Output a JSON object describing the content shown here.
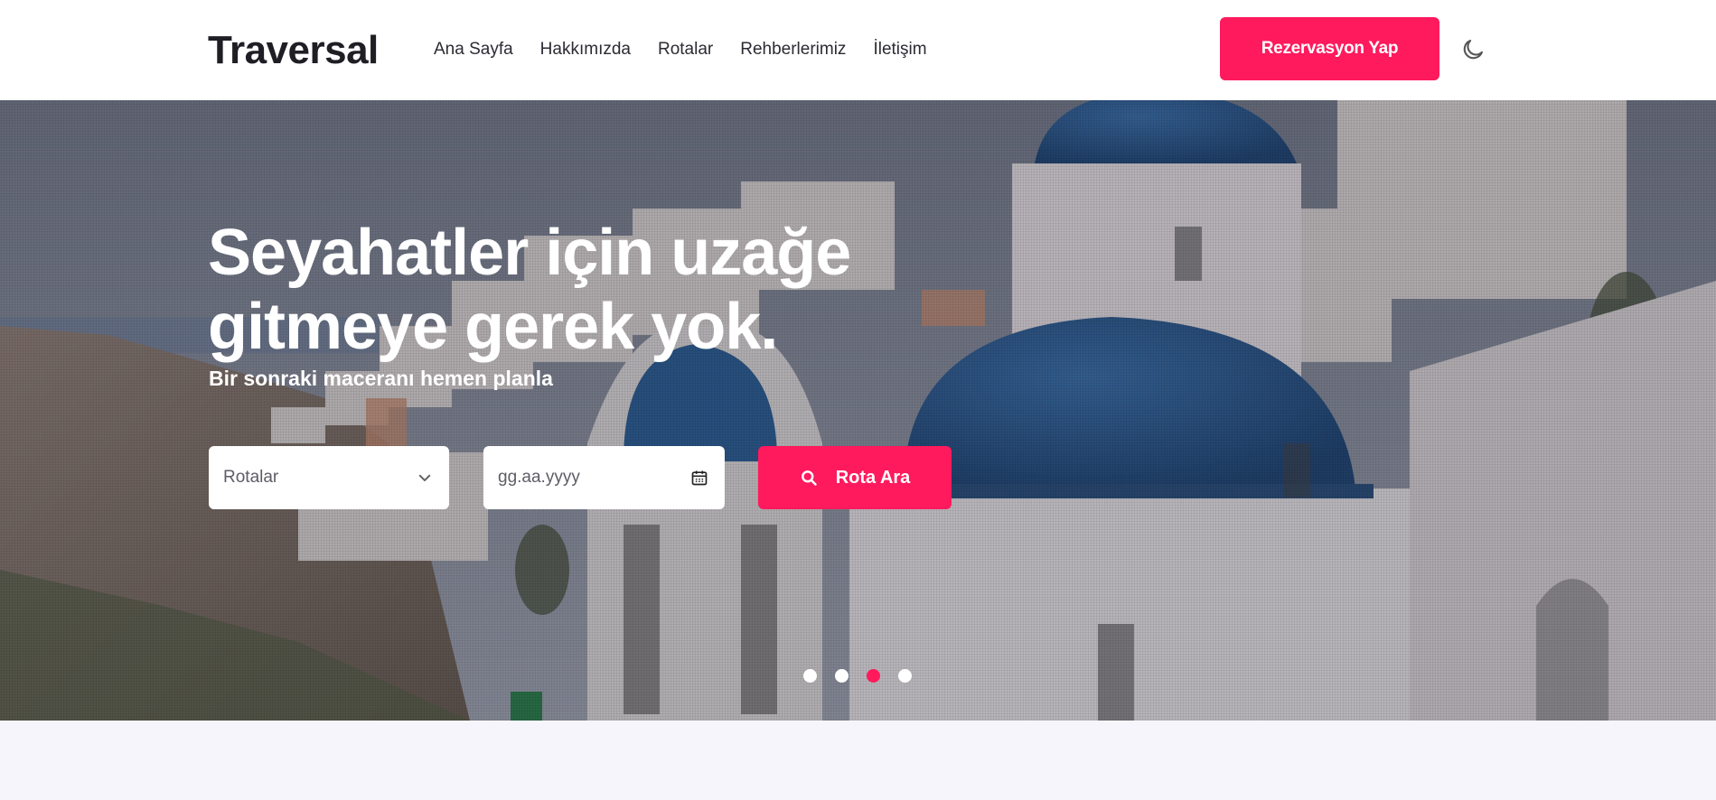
{
  "brand": {
    "name": "Traversal",
    "accent_color": "#fe1a5d"
  },
  "nav": {
    "items": [
      {
        "label": "Ana Sayfa"
      },
      {
        "label": "Hakkımızda"
      },
      {
        "label": "Rotalar"
      },
      {
        "label": "Rehberlerimiz"
      },
      {
        "label": "İletişim"
      }
    ],
    "reserve_label": "Rezervasyon Yap",
    "theme_icon": "moon-icon"
  },
  "hero": {
    "title": "Seyahatler için uzağe gitmeye gerek yok.",
    "subtitle": "Bir sonraki maceranı hemen planla",
    "route_select": {
      "value": "Rotalar",
      "icon": "chevron-down-icon"
    },
    "date_input": {
      "placeholder": "gg.aa.yyyy",
      "icon": "calendar-icon"
    },
    "search_button": {
      "label": "Rota Ara",
      "icon": "search-icon"
    },
    "slider": {
      "count": 4,
      "active_index": 2
    }
  }
}
